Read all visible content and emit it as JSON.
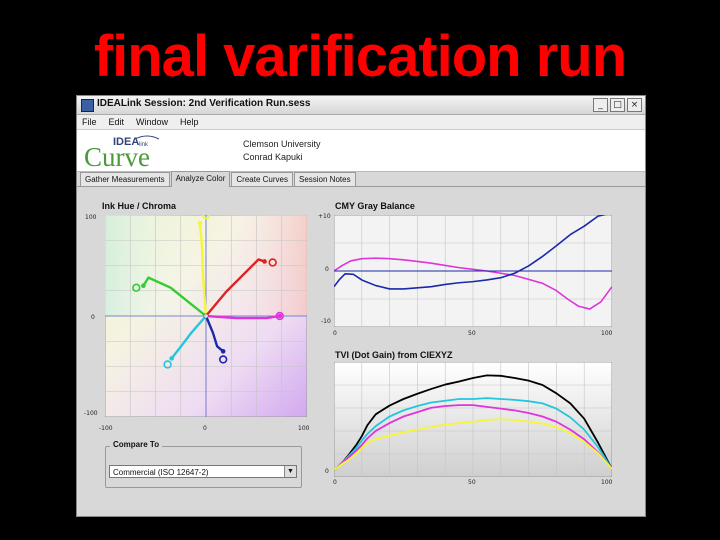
{
  "slide": {
    "title": "final varification run"
  },
  "window": {
    "title": "IDEALink Session: 2nd Verification Run.sess",
    "buttons": {
      "minimize": "_",
      "maximize": "□",
      "close": "×"
    }
  },
  "menu": [
    "File",
    "Edit",
    "Window",
    "Help"
  ],
  "logo": {
    "top_text": "IDEA",
    "small_text": "link",
    "main_text": "Curve"
  },
  "header": {
    "line1": "Clemson University",
    "line2": "Conrad Kapuki"
  },
  "tabs": [
    {
      "label": "Gather Measurements",
      "active": false
    },
    {
      "label": "Analyze Color",
      "active": true
    },
    {
      "label": "Create Curves",
      "active": false
    },
    {
      "label": "Session Notes",
      "active": false
    }
  ],
  "chroma_panel": {
    "title": "Ink Hue / Chroma",
    "y_ticks": [
      "100",
      "0",
      "-100"
    ],
    "x_ticks": [
      "-100",
      "0",
      "100"
    ]
  },
  "gray_panel": {
    "title": "CMY Gray Balance",
    "y_ticks": [
      "+10",
      "0",
      "-10"
    ],
    "x_ticks": [
      "0",
      "50",
      "100"
    ]
  },
  "tvi_panel": {
    "title": "TVI (Dot Gain) from CIEXYZ",
    "y_ticks": [
      "0"
    ],
    "x_ticks": [
      "0",
      "50",
      "100"
    ]
  },
  "compare": {
    "legend": "Compare To",
    "selected": "Commercial (ISO 12647-2)",
    "arrow": "▼"
  },
  "colors": {
    "cyan": "#22c6dd",
    "magenta": "#e033dd",
    "yellow": "#f5f53a",
    "black": "#000000",
    "red": "#dd2222",
    "green": "#33cc33",
    "blue": "#1a2aa8"
  },
  "chart_data": [
    {
      "type": "line",
      "title": "Ink Hue / Chroma",
      "xlim": [
        -100,
        100
      ],
      "ylim": [
        -100,
        100
      ],
      "grid": true,
      "series": [
        {
          "color": "yellow",
          "x": [
            0,
            -3,
            -4,
            -6
          ],
          "y": [
            0,
            40,
            70,
            92
          ]
        },
        {
          "color": "red",
          "x": [
            0,
            20,
            38,
            48,
            52,
            58
          ],
          "y": [
            0,
            24,
            42,
            52,
            56,
            54
          ]
        },
        {
          "color": "green",
          "x": [
            0,
            -15,
            -35,
            -57,
            -62
          ],
          "y": [
            0,
            12,
            28,
            38,
            30
          ]
        },
        {
          "color": "magenta",
          "x": [
            0,
            30,
            60,
            73
          ],
          "y": [
            0,
            -2,
            -2,
            0
          ]
        },
        {
          "color": "cyan",
          "x": [
            0,
            -14,
            -27,
            -34
          ],
          "y": [
            0,
            -16,
            -33,
            -42
          ]
        },
        {
          "color": "blue",
          "x": [
            0,
            7,
            11,
            17
          ],
          "y": [
            0,
            -17,
            -30,
            -35
          ]
        }
      ],
      "solid_points": [
        {
          "color": "yellow",
          "x": 0,
          "y": 100
        },
        {
          "color": "red",
          "x": 66,
          "y": 53
        },
        {
          "color": "green",
          "x": -69,
          "y": 28
        },
        {
          "color": "magenta",
          "x": 73,
          "y": 0
        },
        {
          "color": "cyan",
          "x": -38,
          "y": -48
        },
        {
          "color": "blue",
          "x": 17,
          "y": -43
        }
      ]
    },
    {
      "type": "line",
      "title": "CMY Gray Balance",
      "xlim": [
        0,
        100
      ],
      "ylim": [
        -10,
        10
      ],
      "grid": true,
      "series": [
        {
          "color": "magenta",
          "x": [
            0,
            3,
            6,
            10,
            15,
            20,
            25,
            30,
            35,
            40,
            45,
            50,
            55,
            60,
            65,
            70,
            75,
            80,
            84,
            88,
            92,
            96,
            100
          ],
          "y": [
            0,
            1,
            1.8,
            2.2,
            2.3,
            2.2,
            2,
            1.7,
            1.4,
            1,
            0.6,
            0.3,
            0,
            -0.4,
            -0.8,
            -1.5,
            -2.2,
            -3.5,
            -5,
            -6.3,
            -6.8,
            -5.5,
            -2.8
          ]
        },
        {
          "color": "blue",
          "x": [
            0,
            2,
            4,
            7,
            10,
            15,
            20,
            25,
            30,
            35,
            40,
            45,
            50,
            55,
            60,
            65,
            70,
            75,
            80,
            85,
            90,
            95,
            100
          ],
          "y": [
            -2.8,
            -1.5,
            -0.5,
            -0.6,
            -1.6,
            -2.6,
            -3.2,
            -3.2,
            -3,
            -2.8,
            -2.4,
            -2.1,
            -1.9,
            -1.6,
            -1.2,
            -0.4,
            0.9,
            2.6,
            4.5,
            6.5,
            8,
            9.8,
            11
          ]
        },
        {
          "color": "blue",
          "x": [
            0,
            100
          ],
          "y": [
            0,
            0
          ]
        }
      ]
    },
    {
      "type": "line",
      "title": "TVI (Dot Gain) from CIEXYZ",
      "xlim": [
        0,
        100
      ],
      "grid": true,
      "series": [
        {
          "color": "black",
          "x": [
            0,
            1,
            3,
            5,
            8,
            10,
            12,
            15,
            20,
            25,
            30,
            35,
            40,
            45,
            50,
            55,
            60,
            65,
            70,
            75,
            80,
            85,
            90,
            95,
            100
          ],
          "y": [
            0,
            0.2,
            1.5,
            3,
            5.5,
            7.5,
            10,
            12.5,
            14.5,
            16,
            17.2,
            18.3,
            19.3,
            20,
            20.8,
            21.4,
            21.3,
            20.8,
            20.2,
            19.2,
            17.3,
            15,
            11.5,
            6,
            0
          ]
        },
        {
          "color": "cyan",
          "x": [
            0,
            1,
            3,
            5,
            8,
            10,
            12,
            15,
            20,
            25,
            30,
            35,
            40,
            45,
            50,
            55,
            60,
            65,
            70,
            75,
            80,
            85,
            90,
            95,
            100
          ],
          "y": [
            0,
            0.2,
            1.5,
            2.8,
            4.8,
            6.5,
            8,
            9.8,
            12,
            13.4,
            14.4,
            15.2,
            15.6,
            16,
            16,
            16.2,
            16,
            15.8,
            15.5,
            15,
            13.8,
            11.8,
            9,
            5,
            0
          ]
        },
        {
          "color": "magenta",
          "x": [
            0,
            1,
            3,
            5,
            8,
            10,
            12,
            15,
            20,
            25,
            30,
            35,
            40,
            45,
            50,
            55,
            60,
            65,
            70,
            75,
            80,
            85,
            90,
            95,
            100
          ],
          "y": [
            0,
            0.2,
            1.5,
            2.5,
            4.2,
            5.5,
            7,
            8.7,
            10.5,
            12,
            13,
            14,
            14.4,
            14.6,
            14.6,
            14.2,
            13.8,
            13.4,
            12.8,
            12,
            10.8,
            9,
            6.8,
            3.8,
            0
          ]
        },
        {
          "color": "yellow",
          "x": [
            0,
            1,
            3,
            5,
            8,
            10,
            12,
            15,
            20,
            25,
            30,
            35,
            40,
            45,
            50,
            55,
            60,
            65,
            70,
            75,
            80,
            85,
            90,
            95,
            100
          ],
          "y": [
            0,
            0.2,
            1.2,
            2,
            3.5,
            4.8,
            6,
            6.8,
            7.6,
            8.4,
            9,
            9.6,
            10.2,
            10.5,
            10.8,
            11.2,
            11.4,
            11.2,
            10.8,
            10.4,
            9.6,
            8.2,
            6.2,
            3.6,
            0
          ]
        }
      ]
    }
  ]
}
